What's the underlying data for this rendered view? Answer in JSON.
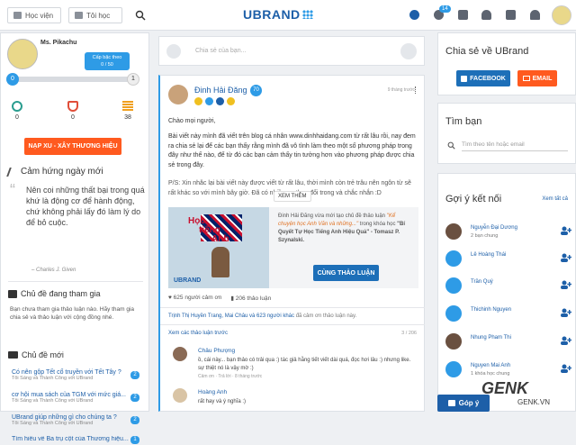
{
  "topbar": {
    "hoc_vien": "Học viện",
    "toi_hoc": "Tôi học",
    "logo": "UBRAND",
    "notif_count": "14"
  },
  "profile": {
    "name": "Ms. Pikachu",
    "level_tooltip_title": "Cấp bậc theo",
    "level_tooltip_value": "0 / 50",
    "level_start": "0",
    "level_end": "1",
    "progress": 0,
    "stats": [
      "0",
      "0",
      "38"
    ],
    "cta": "NẠP XU - XÂY THƯƠNG HIỆU"
  },
  "daily": {
    "title": "Cảm hứng ngày mới",
    "quote": "Nên coi những thất bại trong quá khứ là động cơ để hành động, chứ không phải lấy đó làm lý do để bỏ cuộc.",
    "author": "– Charles J. Given"
  },
  "joined": {
    "title": "Chủ đề đang tham gia",
    "text": "Bạn chưa tham gia thảo luận nào. Hãy tham gia chia sẻ và thảo luận với cộng đồng nhé."
  },
  "newest": {
    "title": "Chủ đề mới",
    "items": [
      {
        "title": "Có nên gộp Tết cổ truyền với Tết Tây ?",
        "sub": "Tôi Sáng và Thành Công với UBrand",
        "count": "2"
      },
      {
        "title": "cơ hội mua sách của TGM với mức giá...",
        "sub": "Tôi Sáng và Thành Công với UBrand",
        "count": "2"
      },
      {
        "title": "UBrand giúp những gì cho chúng ta ?",
        "sub": "Tôi Sáng và Thành Công với UBrand",
        "count": "2"
      },
      {
        "title": "Tìm hiểu về Ba trụ cột của Thương hiệu...",
        "sub": "",
        "count": "1"
      }
    ]
  },
  "composer": {
    "placeholder": "Chia sẻ của bạn..."
  },
  "post": {
    "author": "Đinh Hải Đăng",
    "author_level": "70",
    "time": "9 tháng trước",
    "greeting": "Chào mọi người,",
    "body1": "Bài viết này mình đã viết trên blog cá nhân www.dinhhaidang.com từ rất lâu rồi, nay đem ra chia sẻ lại để các bạn thấy rằng mình đã vô tình làm theo một số phương pháp trong đây như thế nào, để từ đó các bạn cảm thấy tin tưởng hơn vào phương pháp được chia sẻ trong đây.",
    "body2": "P/S: Xin nhắc lại bài viết này được viết từ rất lâu, thời mình còn trẻ trâu nên ngôn từ sẽ rất khác so với mình bây giờ. Đã có nhiều sự thay đổi trong và chắc nhắn :D",
    "see_more": "XEM THÊM",
    "attach_text1": "Đinh Hải Đăng vừa mới tạo chủ đề thảo luận",
    "attach_title": "\"Kể chuyện học Anh Văn và những...\"",
    "attach_text2": "trong khóa học",
    "attach_course": "\"Bí Quyết Tự Học Tiếng Anh Hiệu Quả\"",
    "attach_author": "- Tomasz P. Szynalski.",
    "attach_btn": "CÙNG THẢO LUẬN",
    "banner_text1": "Học",
    "banner_text2": "tiếng",
    "banner_text3": "Anh",
    "banner_logo": "UBRAND",
    "thanks": "625 người cảm ơn",
    "discussions": "206 thảo luận",
    "thanked_by_prefix": "Trịnh Thị Huyền Trang, Mai Châu và 623 người khác",
    "thanked_by_suffix": "đã cảm ơn thảo luận này.",
    "more_discussions": "Xem các thảo luận trước",
    "page": "3 / 206"
  },
  "comments": [
    {
      "name": "Châu Phượng",
      "text": "ồ, cái này... bạn thảo có trải qua :) tác giả hằng tiết viết dài quá, đọc hơi lâu :) nhưng like. sự thiệt nó là vậy mờ :)",
      "meta": "Cảm ơn · Trả lời · 8 tháng trước"
    },
    {
      "name": "Hoàng Anh",
      "text": "rất hay và ý nghĩa :)",
      "meta": ""
    }
  ],
  "share": {
    "title": "Chia sẻ về UBrand",
    "facebook": "FACEBOOK",
    "email": "EMAIL"
  },
  "find": {
    "title": "Tìm bạn",
    "placeholder": "Tìm theo tên hoặc email"
  },
  "suggest": {
    "title": "Gợi ý kết nối",
    "see_all": "Xem tất cả",
    "people": [
      {
        "name": "Nguyễn Đại Dương",
        "sub": "2 bạn chung"
      },
      {
        "name": "Lê Hoàng Thái",
        "sub": ""
      },
      {
        "name": "Trần Quý",
        "sub": ""
      },
      {
        "name": "Thichinh Nguyen",
        "sub": ""
      },
      {
        "name": "Nhung Pham Thi",
        "sub": ""
      },
      {
        "name": "Nguyen Mai Anh",
        "sub": "1 khóa học chung"
      }
    ]
  },
  "feedback": "Góp ý",
  "watermark": "GENK",
  "watermark_url": "GENK.VN"
}
